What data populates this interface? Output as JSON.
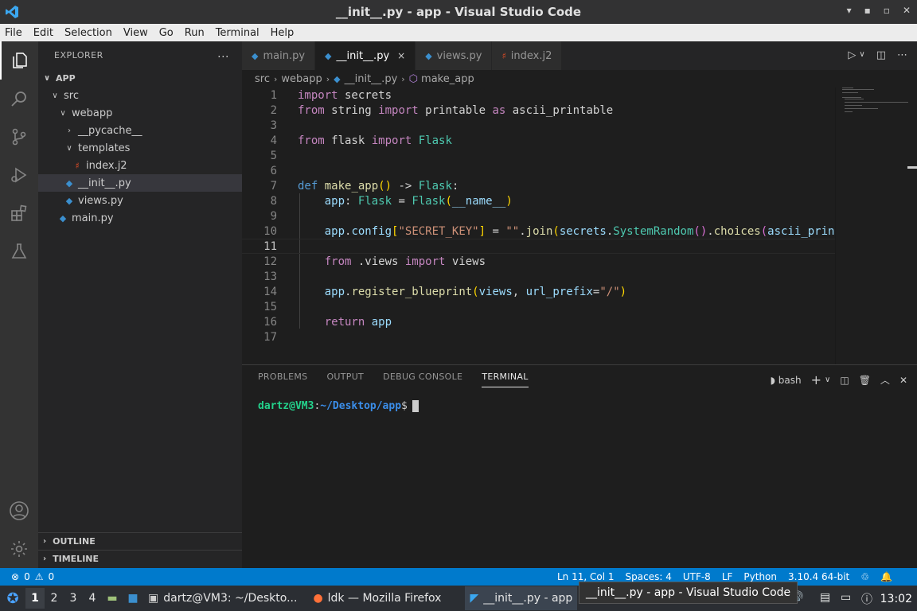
{
  "window": {
    "title": "__init__.py - app - Visual Studio Code"
  },
  "menu": [
    "File",
    "Edit",
    "Selection",
    "View",
    "Go",
    "Run",
    "Terminal",
    "Help"
  ],
  "explorer": {
    "header": "EXPLORER",
    "more": "...",
    "root": "APP",
    "items": [
      {
        "label": "src",
        "chev": "∨"
      },
      {
        "label": "webapp",
        "chev": "∨"
      },
      {
        "label": "__pycache__",
        "chev": "›"
      },
      {
        "label": "templates",
        "chev": "∨"
      },
      {
        "label": "index.j2"
      },
      {
        "label": "__init__.py"
      },
      {
        "label": "views.py"
      },
      {
        "label": "main.py"
      }
    ],
    "outline": "OUTLINE",
    "timeline": "TIMELINE"
  },
  "tabs": [
    {
      "label": "main.py"
    },
    {
      "label": "__init__.py",
      "close": "×"
    },
    {
      "label": "views.py"
    },
    {
      "label": "index.j2"
    }
  ],
  "breadcrumbs": {
    "src": "src",
    "webapp": "webapp",
    "file": "__init__.py",
    "symbol": "make_app"
  },
  "editor": {
    "line_numbers": [
      "1",
      "2",
      "3",
      "4",
      "5",
      "6",
      "7",
      "8",
      "9",
      "10",
      "11",
      "12",
      "13",
      "14",
      "15",
      "16",
      "17"
    ],
    "current_line": 11
  },
  "panel": {
    "tabs": [
      "PROBLEMS",
      "OUTPUT",
      "DEBUG CONSOLE",
      "TERMINAL"
    ],
    "shell": "bash",
    "prompt_user": "dartz@VM3",
    "prompt_sep": ":",
    "prompt_path": "~/Desktop/app",
    "prompt_symbol": "$"
  },
  "status": {
    "errors": "0",
    "warnings": "0",
    "position": "Ln 11, Col 1",
    "spaces": "Spaces: 4",
    "encoding": "UTF-8",
    "eol": "LF",
    "language": "Python",
    "interpreter": "3.10.4 64-bit"
  },
  "taskbar": {
    "workspaces": [
      "1",
      "2",
      "3",
      "4"
    ],
    "tasks": [
      {
        "label": "dartz@VM3: ~/Deskto..."
      },
      {
        "label": "ldk — Mozilla Firefox"
      },
      {
        "label": "__init__.py - app"
      }
    ],
    "tooltip": "__init__.py - app - Visual Studio Code",
    "clock": "13:02"
  }
}
